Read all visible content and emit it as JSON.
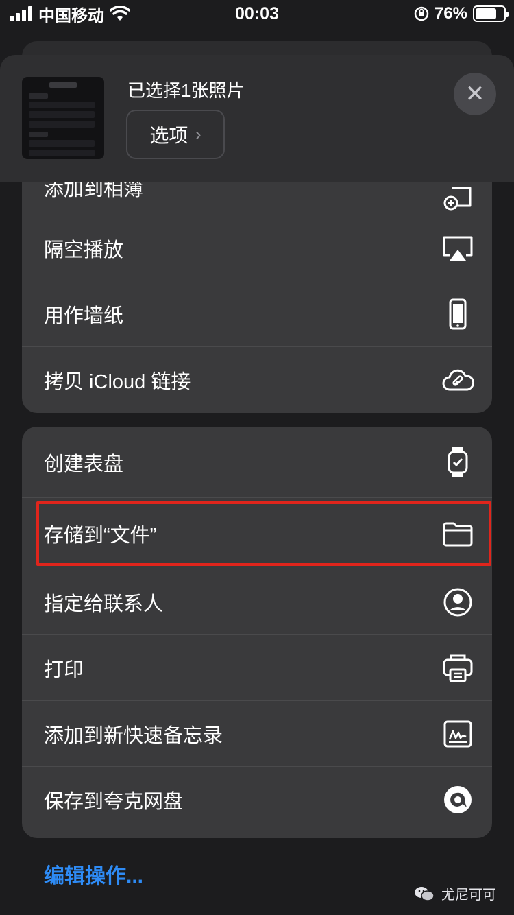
{
  "status_bar": {
    "carrier": "中国移动",
    "time": "00:03",
    "battery_percent": "76%",
    "battery_level": 0.76
  },
  "header": {
    "title": "已选择1张照片",
    "options_label": "选项"
  },
  "group1": {
    "items": [
      {
        "label": "添加到相簿",
        "icon": "add-to-album-icon"
      },
      {
        "label": "隔空播放",
        "icon": "airplay-icon"
      },
      {
        "label": "用作墙纸",
        "icon": "iphone-icon"
      },
      {
        "label": "拷贝 iCloud 链接",
        "icon": "icloud-link-icon"
      }
    ]
  },
  "group2": {
    "items": [
      {
        "label": "创建表盘",
        "icon": "watch-icon"
      },
      {
        "label": "存储到“文件”",
        "icon": "folder-icon"
      },
      {
        "label": "指定给联系人",
        "icon": "contact-icon"
      },
      {
        "label": "打印",
        "icon": "printer-icon"
      },
      {
        "label": "添加到新快速备忘录",
        "icon": "quick-note-icon"
      },
      {
        "label": "保存到夸克网盘",
        "icon": "quark-icon"
      }
    ]
  },
  "edit_actions": "编辑操作...",
  "watermark": "尤尼可可",
  "colors": {
    "background": "#1c1c1e",
    "row_background": "#3a3a3c",
    "highlight": "#e0251c",
    "link": "#2e8bf5"
  }
}
